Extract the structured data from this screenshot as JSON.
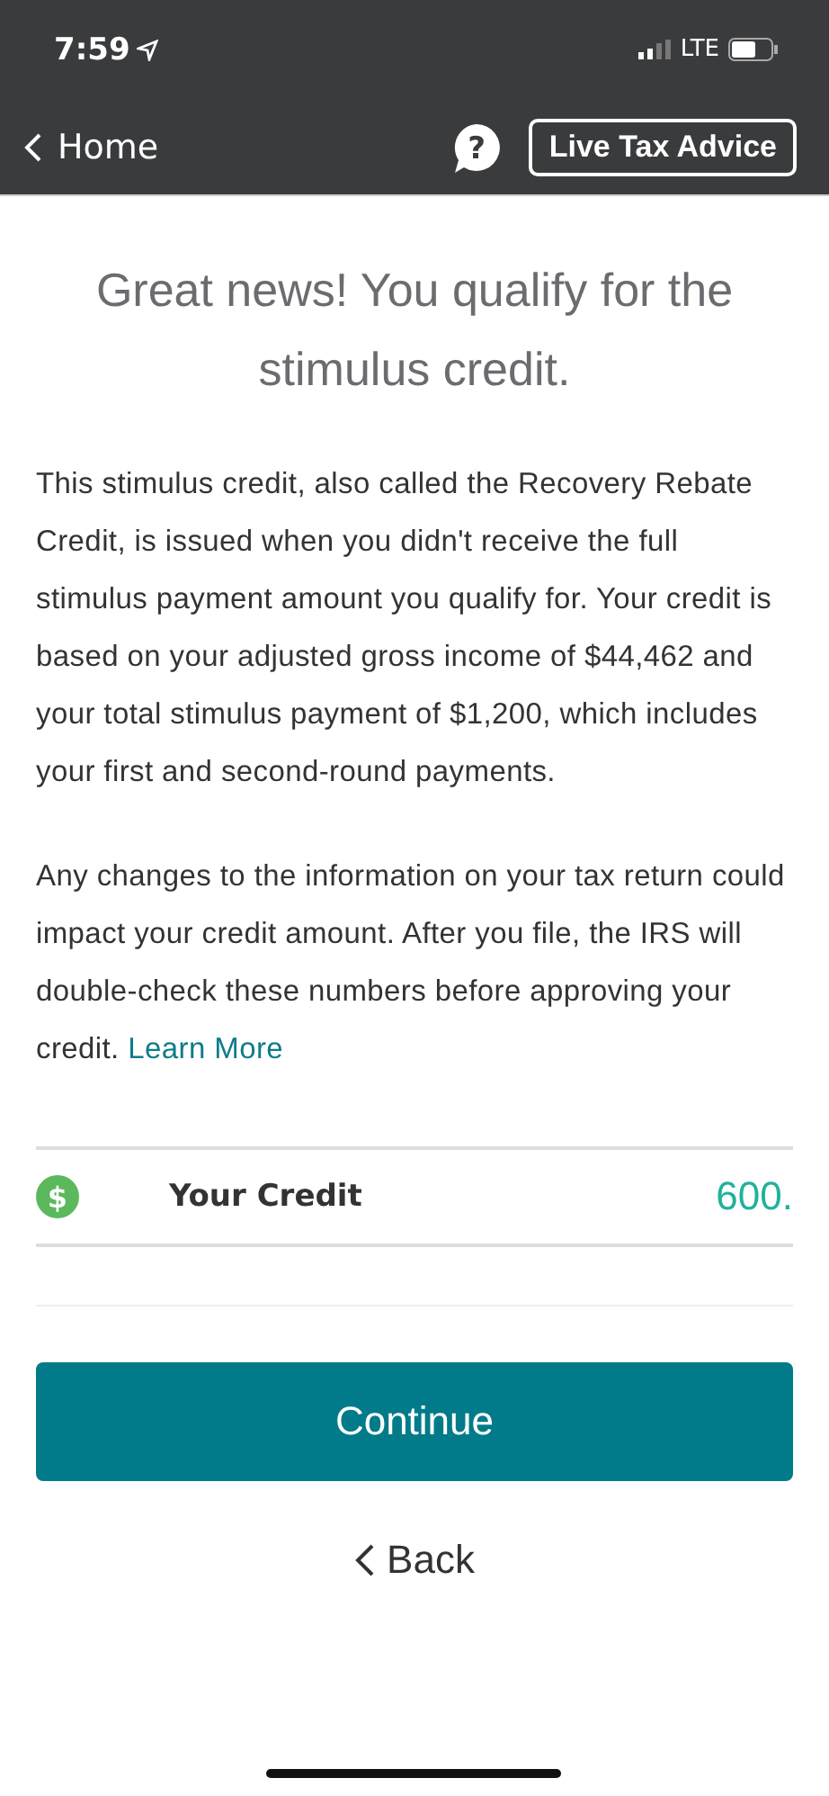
{
  "status_bar": {
    "time": "7:59",
    "network": "LTE"
  },
  "nav": {
    "back_label": "Home",
    "advice_button": "Live Tax Advice",
    "help_glyph": "?"
  },
  "title": "Great news! You qualify for the stimulus credit.",
  "paragraphs": [
    {
      "text": "This stimulus credit, also called the Recovery Rebate Credit, is issued when you didn't receive the full stimulus payment amount you qualify for. Your credit is based on your adjusted gross income of $44,462 and your total stimulus payment of $1,200, which includes your first and second-round payments."
    },
    {
      "text": "Any changes to the information on your tax return could impact your credit amount. After you file, the IRS will double-check these numbers before approving your credit.",
      "link": "Learn More"
    }
  ],
  "credit": {
    "glyph": "$",
    "label": "Your Credit",
    "value": "600."
  },
  "continue_button": "Continue",
  "back_button": "Back"
}
